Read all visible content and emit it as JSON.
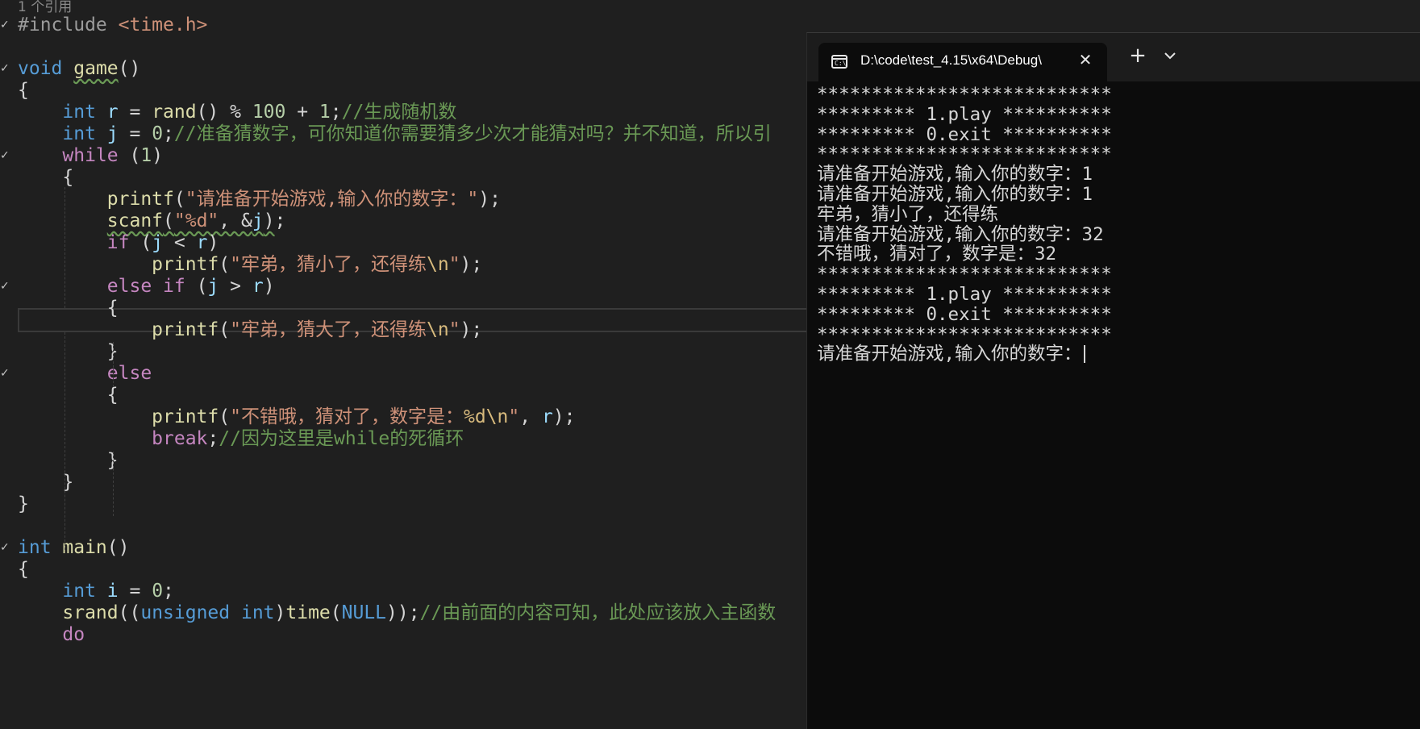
{
  "editor": {
    "codelens": "1 个引用",
    "lines": [
      [
        {
          "c": "pp",
          "t": "#include "
        },
        {
          "c": "inc",
          "t": "<time.h>"
        }
      ],
      [],
      [
        {
          "c": "kw",
          "t": "void "
        },
        {
          "c": "fn squig",
          "t": "game"
        },
        {
          "c": "",
          "t": "()"
        }
      ],
      [
        {
          "c": "",
          "t": "{"
        }
      ],
      [
        {
          "c": "",
          "t": "    "
        },
        {
          "c": "kw",
          "t": "int "
        },
        {
          "c": "var",
          "t": "r"
        },
        {
          "c": "",
          "t": " = "
        },
        {
          "c": "fn",
          "t": "rand"
        },
        {
          "c": "",
          "t": "() % "
        },
        {
          "c": "num",
          "t": "100"
        },
        {
          "c": "",
          "t": " + "
        },
        {
          "c": "num",
          "t": "1"
        },
        {
          "c": "",
          "t": ";"
        },
        {
          "c": "cmt",
          "t": "//生成随机数"
        }
      ],
      [
        {
          "c": "",
          "t": "    "
        },
        {
          "c": "kw",
          "t": "int "
        },
        {
          "c": "var",
          "t": "j"
        },
        {
          "c": "",
          "t": " = "
        },
        {
          "c": "num",
          "t": "0"
        },
        {
          "c": "",
          "t": ";"
        },
        {
          "c": "cmt",
          "t": "//准备猜数字，可你知道你需要猜多少次才能猜对吗？并不知道，所以引"
        }
      ],
      [
        {
          "c": "",
          "t": "    "
        },
        {
          "c": "ctl",
          "t": "while"
        },
        {
          "c": "",
          "t": " ("
        },
        {
          "c": "num",
          "t": "1"
        },
        {
          "c": "",
          "t": ")"
        }
      ],
      [
        {
          "c": "",
          "t": "    {"
        }
      ],
      [
        {
          "c": "",
          "t": "        "
        },
        {
          "c": "fn",
          "t": "printf"
        },
        {
          "c": "",
          "t": "("
        },
        {
          "c": "str",
          "t": "\"请准备开始游戏,输入你的数字：\""
        },
        {
          "c": "",
          "t": ");"
        }
      ],
      [
        {
          "c": "",
          "t": "        "
        },
        {
          "c": "fn squig",
          "t": "scanf"
        },
        {
          "c": "squig",
          "t": "("
        },
        {
          "c": "str squig",
          "t": "\"%d\""
        },
        {
          "c": "squig",
          "t": ", &"
        },
        {
          "c": "var squig",
          "t": "j"
        },
        {
          "c": "squig",
          "t": ")"
        },
        {
          "c": "",
          "t": ";"
        }
      ],
      [
        {
          "c": "",
          "t": "        "
        },
        {
          "c": "ctl",
          "t": "if"
        },
        {
          "c": "",
          "t": " ("
        },
        {
          "c": "var",
          "t": "j"
        },
        {
          "c": "",
          "t": " < "
        },
        {
          "c": "var",
          "t": "r"
        },
        {
          "c": "",
          "t": ")"
        }
      ],
      [
        {
          "c": "",
          "t": "            "
        },
        {
          "c": "fn",
          "t": "printf"
        },
        {
          "c": "",
          "t": "("
        },
        {
          "c": "str",
          "t": "\"牢弟，猜小了，还得练"
        },
        {
          "c": "esc",
          "t": "\\n"
        },
        {
          "c": "str",
          "t": "\""
        },
        {
          "c": "",
          "t": ");"
        }
      ],
      [
        {
          "c": "",
          "t": "        "
        },
        {
          "c": "ctl",
          "t": "else if"
        },
        {
          "c": "",
          "t": " ("
        },
        {
          "c": "var",
          "t": "j"
        },
        {
          "c": "",
          "t": " > "
        },
        {
          "c": "var",
          "t": "r"
        },
        {
          "c": "",
          "t": ")"
        }
      ],
      [
        {
          "c": "",
          "t": "        {"
        }
      ],
      [
        {
          "c": "",
          "t": "            "
        },
        {
          "c": "fn",
          "t": "printf"
        },
        {
          "c": "",
          "t": "("
        },
        {
          "c": "str",
          "t": "\"牢弟，猜大了，还得练"
        },
        {
          "c": "esc",
          "t": "\\n"
        },
        {
          "c": "str",
          "t": "\""
        },
        {
          "c": "",
          "t": ");"
        }
      ],
      [
        {
          "c": "",
          "t": "        }"
        }
      ],
      [
        {
          "c": "",
          "t": "        "
        },
        {
          "c": "ctl",
          "t": "else"
        }
      ],
      [
        {
          "c": "",
          "t": "        {"
        }
      ],
      [
        {
          "c": "",
          "t": "            "
        },
        {
          "c": "fn",
          "t": "printf"
        },
        {
          "c": "",
          "t": "("
        },
        {
          "c": "str",
          "t": "\"不错哦，猜对了，数字是："
        },
        {
          "c": "esc",
          "t": "%d\\n"
        },
        {
          "c": "str",
          "t": "\""
        },
        {
          "c": "",
          "t": ", "
        },
        {
          "c": "var",
          "t": "r"
        },
        {
          "c": "",
          "t": ");"
        }
      ],
      [
        {
          "c": "",
          "t": "            "
        },
        {
          "c": "ctl",
          "t": "break"
        },
        {
          "c": "",
          "t": ";"
        },
        {
          "c": "cmt",
          "t": "//因为这里是while的死循环"
        }
      ],
      [
        {
          "c": "",
          "t": "        }"
        }
      ],
      [
        {
          "c": "",
          "t": "    }"
        }
      ],
      [
        {
          "c": "",
          "t": "}"
        }
      ],
      [],
      [
        {
          "c": "kw",
          "t": "int "
        },
        {
          "c": "fn",
          "t": "main"
        },
        {
          "c": "",
          "t": "()"
        }
      ],
      [
        {
          "c": "",
          "t": "{"
        }
      ],
      [
        {
          "c": "",
          "t": "    "
        },
        {
          "c": "kw",
          "t": "int "
        },
        {
          "c": "var",
          "t": "i"
        },
        {
          "c": "",
          "t": " = "
        },
        {
          "c": "num",
          "t": "0"
        },
        {
          "c": "",
          "t": ";"
        }
      ],
      [
        {
          "c": "",
          "t": "    "
        },
        {
          "c": "fn",
          "t": "srand"
        },
        {
          "c": "",
          "t": "(("
        },
        {
          "c": "kw",
          "t": "unsigned int"
        },
        {
          "c": "",
          "t": ")"
        },
        {
          "c": "fn",
          "t": "time"
        },
        {
          "c": "",
          "t": "("
        },
        {
          "c": "mac",
          "t": "NULL"
        },
        {
          "c": "",
          "t": "));"
        },
        {
          "c": "cmt",
          "t": "//由前面的内容可知，此处应该放入主函数"
        }
      ],
      [
        {
          "c": "",
          "t": "    "
        },
        {
          "c": "ctl",
          "t": "do"
        }
      ]
    ],
    "fold_marks": [
      "✓",
      "",
      "✓",
      "",
      "",
      "",
      "✓",
      "",
      "",
      "",
      "",
      "",
      "✓",
      "",
      "",
      "",
      "✓",
      "",
      "",
      "",
      "",
      "",
      "",
      "",
      "✓",
      "",
      "",
      ""
    ]
  },
  "terminal": {
    "tab_title": "D:\\code\\test_4.15\\x64\\Debug\\",
    "tab_icon_glyph": "C:\\",
    "close_glyph": "✕",
    "new_tab_glyph": "+",
    "output_lines": [
      "***************************",
      "********* 1.play **********",
      "********* 0.exit **********",
      "***************************",
      "请准备开始游戏,输入你的数字：1",
      "请准备开始游戏,输入你的数字：1",
      "牢弟，猜小了，还得练",
      "请准备开始游戏,输入你的数字：32",
      "不错哦，猜对了，数字是：32",
      "***************************",
      "********* 1.play **********",
      "********* 0.exit **********",
      "***************************",
      "请准备开始游戏,输入你的数字："
    ]
  }
}
